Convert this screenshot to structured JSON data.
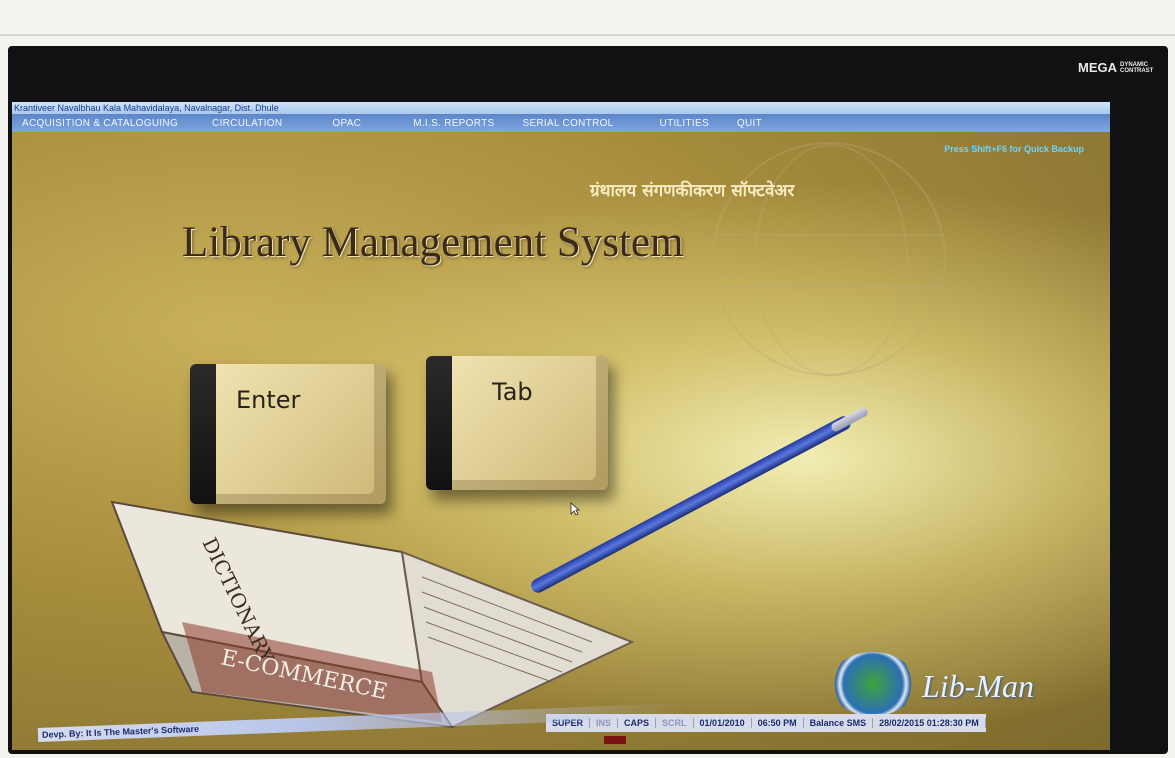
{
  "monitor": {
    "brand_name": "MEGA",
    "brand_sub": "DYNAMIC CONTRAST"
  },
  "window": {
    "title": "Krantiveer Navalbhau Kala Mahavidalaya, Navalnagar, Dist. Dhule"
  },
  "menu": {
    "items": [
      {
        "label": "ACQUISITION & CATALOGUING"
      },
      {
        "label": "CIRCULATION"
      },
      {
        "label": "OPAC"
      },
      {
        "label": "M.I.S. REPORTS"
      },
      {
        "label": "SERIAL CONTROL"
      },
      {
        "label": "UTILITIES"
      },
      {
        "label": "QUIT"
      }
    ]
  },
  "splash": {
    "backup_hint": "Press Shift+F6 for Quick Backup",
    "hindi_title": "ग्रंथालय संगणकीकरण सॉफ्टवेअर",
    "title": "Library Management System",
    "key_enter": "Enter",
    "key_tab": "Tab",
    "book_spine": "DICTIONARY",
    "book_cover": "E-COMMERCE",
    "logo_text": "Lib-Man"
  },
  "statusbar": {
    "mode": "SUPER",
    "ins": "INS",
    "caps": "CAPS",
    "scrl": "SCRL",
    "date": "01/01/2010",
    "time": "06:50 PM",
    "balance": "Balance SMS",
    "datetime": "28/02/2015 01:28:30 PM"
  },
  "footer": {
    "developer": "Devp. By: It Is The Master's Software"
  },
  "colors": {
    "menu_bg": "#6f98d8",
    "hint": "#6ed4ff",
    "title_text": "#3a2a17"
  }
}
